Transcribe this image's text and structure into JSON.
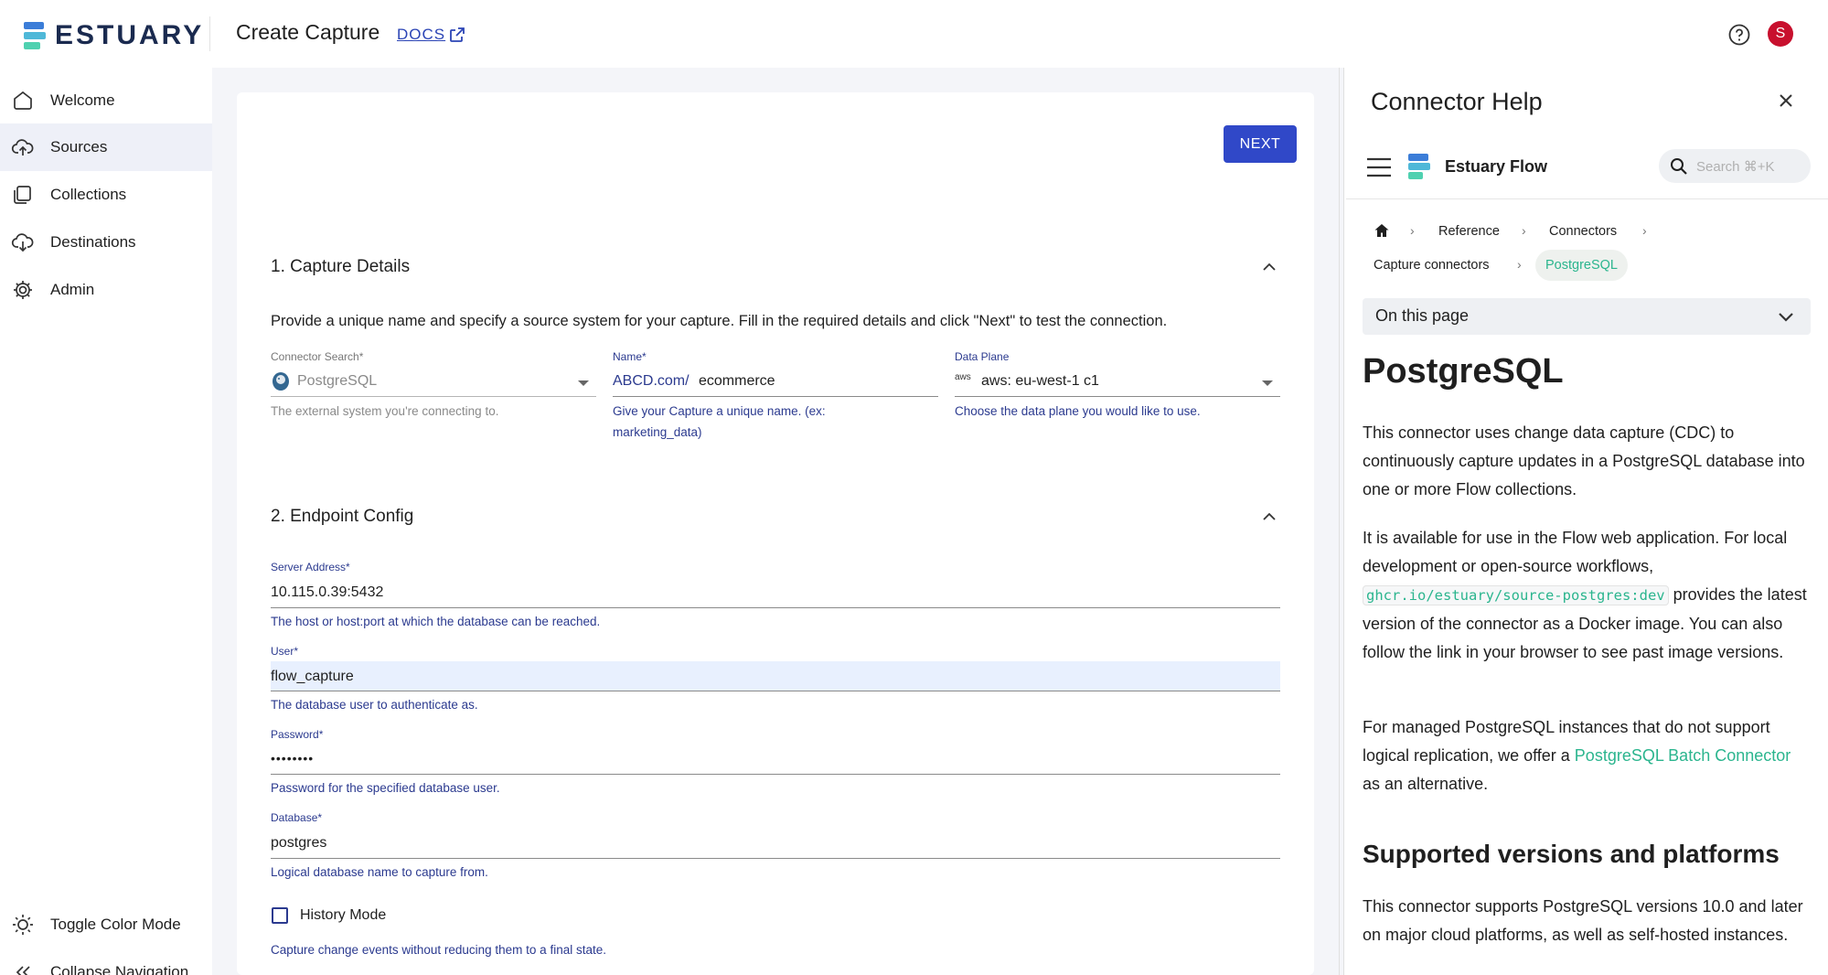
{
  "brand": {
    "name": "ESTUARY",
    "colors": {
      "teal": "#4fd1b0",
      "blue": "#3b7dd8",
      "navy": "#1a2a4f"
    }
  },
  "header": {
    "title": "Create Capture",
    "docs_label": "DOCS",
    "avatar_initial": "S"
  },
  "sidebar": {
    "items": [
      {
        "label": "Welcome",
        "icon": "home-icon"
      },
      {
        "label": "Sources",
        "icon": "cloud-upload-icon",
        "active": true
      },
      {
        "label": "Collections",
        "icon": "collections-icon"
      },
      {
        "label": "Destinations",
        "icon": "cloud-download-icon"
      },
      {
        "label": "Admin",
        "icon": "gear-icon"
      }
    ],
    "bottom": [
      {
        "label": "Toggle Color Mode",
        "icon": "sun-icon"
      },
      {
        "label": "Collapse Navigation",
        "icon": "double-chevron-left-icon"
      }
    ]
  },
  "form": {
    "next_label": "NEXT",
    "capture_details": {
      "title": "1. Capture Details",
      "description": "Provide a unique name and specify a source system for your capture. Fill in the required details and click \"Next\" to test the connection.",
      "connector": {
        "label": "Connector Search",
        "required": "*",
        "value": "PostgreSQL",
        "helper": "The external system you're connecting to."
      },
      "name": {
        "label": "Name",
        "required": "*",
        "prefix": "ABCD.com/",
        "value": "ecommerce",
        "helper_line1": "Give your Capture a unique name. (ex:",
        "helper_line2": "marketing_data)"
      },
      "data_plane": {
        "label": "Data Plane",
        "value": "aws: eu-west-1 c1",
        "badge": "aws",
        "helper": "Choose the data plane you would like to use."
      }
    },
    "endpoint_config": {
      "title": "2. Endpoint Config",
      "server_address": {
        "label": "Server Address",
        "required": "*",
        "value": "10.115.0.39:5432",
        "helper": "The host or host:port at which the database can be reached."
      },
      "user": {
        "label": "User",
        "required": "*",
        "value": "flow_capture",
        "helper": "The database user to authenticate as."
      },
      "password": {
        "label": "Password",
        "required": "*",
        "value": "••••••••",
        "helper": "Password for the specified database user."
      },
      "database": {
        "label": "Database",
        "required": "*",
        "value": "postgres",
        "helper": "Logical database name to capture from."
      },
      "history_mode": {
        "label": "History Mode",
        "checked": false,
        "helper": "Capture change events without reducing them to a final state."
      }
    }
  },
  "help_panel": {
    "title": "Connector Help",
    "brand": "Estuary Flow",
    "search_placeholder": "Search ⌘+K",
    "breadcrumb": [
      "Reference",
      "Connectors",
      "Capture connectors",
      "PostgreSQL"
    ],
    "on_this_page": "On this page",
    "doc": {
      "h1": "PostgreSQL",
      "p1": "This connector uses change data capture (CDC) to continuously capture updates in a PostgreSQL database into one or more Flow collections.",
      "p2_before": "It is available for use in the Flow web application. For local development or open-source workflows, ",
      "p2_code": "ghcr.io/estuary/source-postgres:dev",
      "p2_after": " provides the latest version of the connector as a Docker image. You can also follow the link in your browser to see past image versions.",
      "p3_before": "For managed PostgreSQL instances that do not support logical replication, we offer a ",
      "p3_link": "PostgreSQL Batch Connector",
      "p3_after": " as an alternative.",
      "h2": "Supported versions and platforms",
      "p4": "This connector supports PostgreSQL versions 10.0 and later on major cloud platforms, as well as self-hosted instances."
    }
  }
}
